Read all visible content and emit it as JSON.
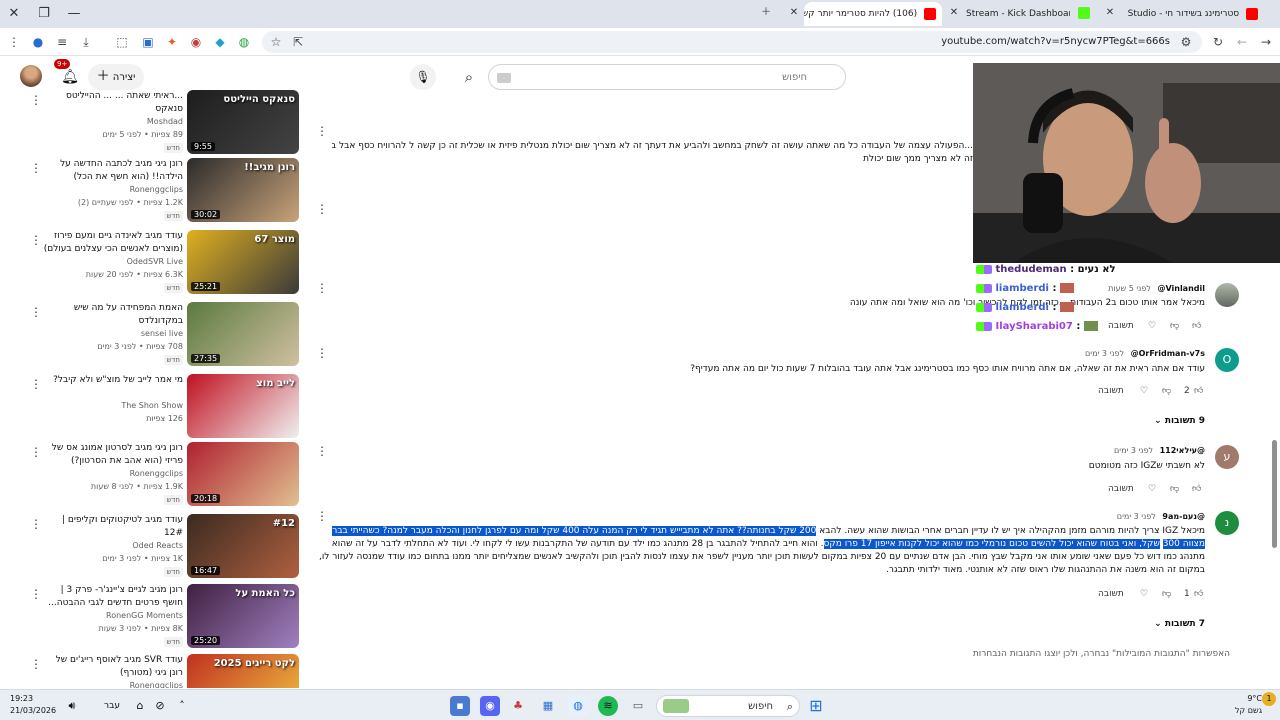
{
  "browser": {
    "tabs": [
      {
        "label": "סטרימינג בשידור חי - Studio",
        "favicon_color": "#ff0000"
      },
      {
        "label": "Stream - Kick Dashboard",
        "favicon_color": "#53fc18"
      },
      {
        "label": "(106) להיות סטרימר יותר קשה",
        "favicon_color": "#ff0000"
      }
    ],
    "url": "youtube.com/watch?v=r5nycw7PTeg&t=666s"
  },
  "header": {
    "search_placeholder": "חיפוש",
    "create_label": "יצירה",
    "notif_count": "9+"
  },
  "sidebar": {
    "items": [
      {
        "title": "...ראיתי שאתה ... ... ההייליטס סנאקס",
        "channel": "Moshdad",
        "meta": "89 צפיות • לפני 5 ימים",
        "badge": "חדש",
        "duration": "9:55",
        "thumb_text": "סנאקס הייליטס",
        "thumb_colors": [
          "#1d1d1d",
          "#444"
        ]
      },
      {
        "title": "רונן גיגי מגיב לכתבה החדשה על הילדה!! (הוא חשף את הכל)",
        "channel": "Ronenggclips",
        "meta": "1.2K צפיות • לפני שעתיים (2)",
        "badge": "חדש",
        "duration": "30:02",
        "thumb_text": "רונן מגיב!!",
        "thumb_colors": [
          "#2b2b2b",
          "#c8a37a"
        ]
      },
      {
        "title": "עודד מגיב לאינדה גיים ומעם פירוז (מוצרים לאנשים הכי עצלנים בעולם)",
        "channel": "OdedSVR Live",
        "meta": "6.3K צפיות • לפני 20 שעות",
        "badge": "חדש",
        "duration": "25:21",
        "thumb_text": "מוצר 67",
        "thumb_colors": [
          "#e0b020",
          "#3a3a3a"
        ]
      },
      {
        "title": "האמת המפחידה על מה שיש במקדונלדס",
        "channel": "sensei live",
        "meta": "708 צפיות • לפני 3 ימים",
        "badge": "חדש",
        "duration": "27:35",
        "thumb_text": "",
        "thumb_colors": [
          "#5a7a40",
          "#d0c0a0"
        ]
      },
      {
        "title": "מי אמר לייב של מוצ\"ש ולא קיבל?",
        "channel": "The Shon Show",
        "meta": "126 צפיות",
        "badge": "",
        "duration": "",
        "thumb_text": "לייב מוצ",
        "thumb_colors": [
          "#c01020",
          "#f0f0f0"
        ]
      },
      {
        "title": "רונן גיגי מגיב לסרטון אמונג אס של פריזי (הוא אהב את הסרטון?)",
        "channel": "Ronenggclips",
        "meta": "1.9K צפיות • לפני 8 שעות",
        "badge": "חדש",
        "duration": "20:18",
        "thumb_text": "",
        "thumb_colors": [
          "#b02030",
          "#e0c090"
        ]
      },
      {
        "title": "עודד מגיב לטיקטוקים וקליפים | 12#",
        "channel": "Oded Reacts",
        "meta": "1K צפיות • לפני 3 ימים",
        "badge": "חדש",
        "duration": "16:47",
        "thumb_text": "#12",
        "thumb_colors": [
          "#3a2a20",
          "#b06040"
        ]
      },
      {
        "title": "רונן מגיב לגיים צ'יינג'ר- פרק 3 | חושף פרטים חדשים לגבי ההבטה...",
        "channel": "RonenGG Moments",
        "meta": "8K צפיות • לפני 3 שעות",
        "badge": "חדש",
        "duration": "25:20",
        "thumb_text": "כל האמת על",
        "thumb_colors": [
          "#402040",
          "#a080c0"
        ]
      },
      {
        "title": "עודד SVR מגיב לאוסף רייג'ים של רונן גיגי (מטורף)",
        "channel": "Ronenggclips",
        "meta": "",
        "badge": "",
        "duration": "",
        "thumb_text": "לקט רייגים 2025",
        "thumb_colors": [
          "#c03020",
          "#f0c040"
        ]
      }
    ]
  },
  "comments": [
    {
      "text": "...הפעולה עצמה של העבודה כל מה שאתה עושה זה לשחק במחשב ולהביע את דעתך זה לא מצריך שום יכולת מנטלית פיזית או שכלית זה כן קשה ל להרוויח כסף אבל בחייאת גם אם",
      "text2": "זה לא מצריך ממך שום יכולת"
    },
    {
      "author": "Vinlandil@",
      "time": "לפני 5 שעות",
      "text": "מיכאל אמר אותו טכום ב2 העבודות ...כזה זמן לקח להכשיר וכו' מה הוא שואל ומה אתה עונה",
      "reply": "תשובה",
      "likes": "",
      "avatar_color": "#8a9a8a",
      "avatar_letter": ""
    },
    {
      "author": "OrFridman-v7s@",
      "time": "לפני 3 ימים",
      "text": "עודד אם אתה ראית את זה שאלה, אם אתה מרוויח אותו כסף כמו בסטרימינג אבל אתה עובד בהובלות 7 שעות כול יום מה אתה מעדיף?",
      "reply": "תשובה",
      "likes": "2",
      "replies": "9 תשובות",
      "avatar_color": "#0e9c8c",
      "avatar_letter": "O"
    },
    {
      "author": "@עילאי112",
      "time": "לפני 3 ימים",
      "text": "לא חשבתי שIGZ כזה מטומטם",
      "reply": "תשובה",
      "likes": "",
      "avatar_color": "#a07a6a",
      "avatar_letter": "ע"
    },
    {
      "author": "@נעם-מ9a",
      "time": "לפני 3 ימים",
      "text_a": "מיכאל IGZ צריך להיות מורהם מזמן מהקהילה איך יש לו עדיין חברים אחרי הבושות שהוא עשה. להבא ",
      "text_hl": "200 שקל בחנותה?? אתה לא מתביייש תגיד לי רק המנה עלה 400 שקל ומה עם לפרגן לחנון והכלה מעבר למנה? כשהייתי בבר מצווה 300",
      "text_hl2": "שקל, ואני בטוח שהוא יכול להשים טכום נורמלי כמו שהוא יכול לקנות אייפון 17 פרו מקס",
      "text_b": ". והוא חייב להתחיל להתבגר בן 28 מתנהג כמו ילד עם תודעה של התקרבנות עשו לי לקחו לי. ועוד לא התחלתי לדבר על זה שהוא מתנהג כמו דוש כל פעם שאני שומע אותו אני מקבל שבץ מוחי. הבן אדם שנתיים עם 20 צפיות במקום לעשות תוכן יותר מעניין לשפר את עצמו לנסות להבין תוכן ולהקשיב לאנשים שמצליחים יותר ממנו בתחום כמו עודד שמנסה לעזור לו, במקום זה הוא משנה את ההתנהגות שלו ראוס שזה לא",
      "text_c": "אותנטי. מאוד ילדותי תתבגר.",
      "reply": "תשובה",
      "likes": "1",
      "replies": "7 תשובות",
      "avatar_color": "#1e8e3e",
      "avatar_letter": "נ"
    },
    {
      "notice": "האפשרות \"התגובות המובילות\" נבחרה, ולכן יוצגו התגובות הנבחרות"
    }
  ],
  "stream_chat": [
    {
      "user": "thedudeman",
      "msg": "לא נעים",
      "color": "#4a2a7a"
    },
    {
      "user": "liamberdi",
      "msg": "",
      "color": "#3a5fd0"
    },
    {
      "user": "liamberdi",
      "msg": "",
      "color": "#3a5fd0"
    },
    {
      "user": "IlaySharabi07",
      "msg": "",
      "color": "#a040e0"
    }
  ],
  "taskbar": {
    "search_placeholder": "חיפוש",
    "time": "19:23",
    "date": "21/03/2026",
    "lang": "עבר",
    "temp": "9°C",
    "weather": "גשם קל"
  }
}
